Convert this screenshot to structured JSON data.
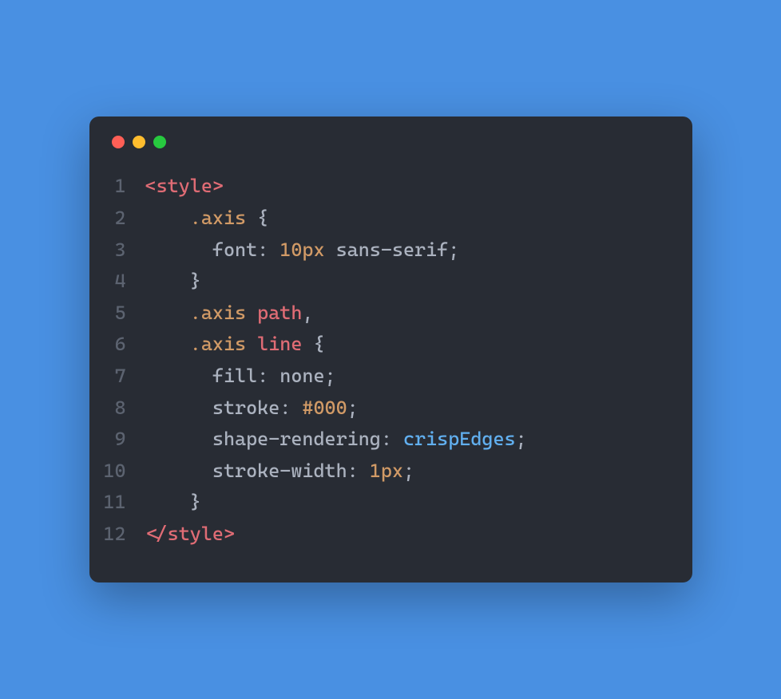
{
  "window": {
    "traffic_lights": {
      "close_color": "#ff5f56",
      "minimize_color": "#ffbd2e",
      "maximize_color": "#27c93f"
    }
  },
  "code": {
    "lines": [
      {
        "num": "1",
        "indent": "",
        "tokens": [
          {
            "t": "<style>",
            "c": "tok-tag"
          }
        ]
      },
      {
        "num": "2",
        "indent": "    ",
        "tokens": [
          {
            "t": ".axis",
            "c": "tok-selector-class"
          },
          {
            "t": " {",
            "c": "tok-punct"
          }
        ]
      },
      {
        "num": "3",
        "indent": "      ",
        "tokens": [
          {
            "t": "font",
            "c": "tok-prop"
          },
          {
            "t": ": ",
            "c": "tok-punct"
          },
          {
            "t": "10px",
            "c": "tok-value-num"
          },
          {
            "t": " sans-serif;",
            "c": "tok-value-kw"
          }
        ]
      },
      {
        "num": "4",
        "indent": "    ",
        "tokens": [
          {
            "t": "}",
            "c": "tok-punct"
          }
        ]
      },
      {
        "num": "5",
        "indent": "    ",
        "tokens": [
          {
            "t": ".axis",
            "c": "tok-selector-class"
          },
          {
            "t": " ",
            "c": "tok-plain"
          },
          {
            "t": "path",
            "c": "tok-selector-tag"
          },
          {
            "t": ",",
            "c": "tok-punct"
          }
        ]
      },
      {
        "num": "6",
        "indent": "    ",
        "tokens": [
          {
            "t": ".axis",
            "c": "tok-selector-class"
          },
          {
            "t": " ",
            "c": "tok-plain"
          },
          {
            "t": "line",
            "c": "tok-selector-tag"
          },
          {
            "t": " {",
            "c": "tok-punct"
          }
        ]
      },
      {
        "num": "7",
        "indent": "      ",
        "tokens": [
          {
            "t": "fill",
            "c": "tok-prop"
          },
          {
            "t": ": none;",
            "c": "tok-punct"
          }
        ]
      },
      {
        "num": "8",
        "indent": "      ",
        "tokens": [
          {
            "t": "stroke",
            "c": "tok-prop"
          },
          {
            "t": ": ",
            "c": "tok-punct"
          },
          {
            "t": "#000",
            "c": "tok-value-num"
          },
          {
            "t": ";",
            "c": "tok-punct"
          }
        ]
      },
      {
        "num": "9",
        "indent": "      ",
        "tokens": [
          {
            "t": "shape-rendering",
            "c": "tok-prop"
          },
          {
            "t": ": ",
            "c": "tok-punct"
          },
          {
            "t": "crispEdges",
            "c": "tok-value-ident"
          },
          {
            "t": ";",
            "c": "tok-punct"
          }
        ]
      },
      {
        "num": "10",
        "indent": "      ",
        "tokens": [
          {
            "t": "stroke-width",
            "c": "tok-prop"
          },
          {
            "t": ": ",
            "c": "tok-punct"
          },
          {
            "t": "1px",
            "c": "tok-value-num"
          },
          {
            "t": ";",
            "c": "tok-punct"
          }
        ]
      },
      {
        "num": "11",
        "indent": "    ",
        "tokens": [
          {
            "t": "}",
            "c": "tok-punct"
          }
        ]
      },
      {
        "num": "12",
        "indent": "",
        "tokens": [
          {
            "t": "</style>",
            "c": "tok-tag"
          }
        ]
      }
    ]
  }
}
